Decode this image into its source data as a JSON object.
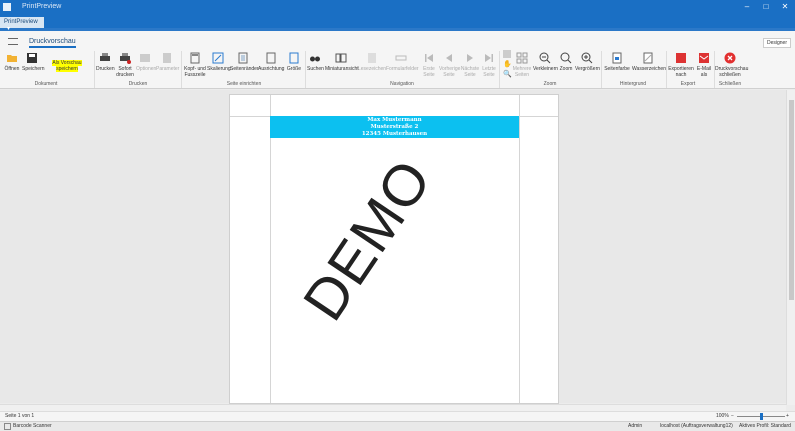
{
  "window": {
    "title": "PrintPreview"
  },
  "tabs": {
    "document_tab": "PrintPreview"
  },
  "ribbon": {
    "tab": "Druckvorschau",
    "designer_label": "Designer",
    "buttons": {
      "open": "Öffnen",
      "save": "Speichern",
      "save_as_preview": "Als Vorschau speichern",
      "print": "Drucken",
      "print_now": "Sofort drucken",
      "options": "Optionen",
      "parameters": "Parameter",
      "header_footer": "Kopf- und Fusszeile",
      "scaling": "Skalierung",
      "margins": "Seitenränder",
      "orientation": "Ausrichtung",
      "size": "Größe",
      "search": "Suchen",
      "thumbnails": "Miniaturansicht",
      "bookmarks": "Lesezeichen",
      "form_fields": "Formularfelder",
      "first_page": "Erste Seite",
      "prev_page": "Vorherige Seite",
      "next_page": "Nächste Seite",
      "last_page": "Letzte Seite",
      "multiple_pages": "Mehrere Seiten",
      "zoom_out": "Verkleinern",
      "zoom": "Zoom",
      "zoom_in": "Vergrößern",
      "page_color": "Seitenfarbe",
      "watermark": "Wasserzeichen",
      "export_to": "Exportieren nach",
      "email_as": "E-Mail als",
      "close_preview": "Druckvorschau schließen"
    },
    "groups": {
      "document": "Dokument",
      "print": "Drucken",
      "page_setup": "Seite einrichten",
      "navigation": "Navigation",
      "zoom": "Zoom",
      "background": "Hintergrund",
      "export": "Export",
      "close": "Schließen"
    }
  },
  "page": {
    "header_line1": "Max Mustermann",
    "header_line2": "Musterstraße 2",
    "header_line3": "12345 Musterhausen",
    "watermark_text": "DEMO"
  },
  "status": {
    "page_info": "Seite 1 von 1",
    "zoom_level": "100%",
    "barcode": "Barcode Scanner",
    "user": "Admin",
    "server": "localhost (Auftragsverwaltung12)",
    "profile": "Aktives Profil: Standard"
  },
  "colors": {
    "titlebar": "#1a6fc4",
    "header_band": "#0cc0f0",
    "highlight": "#ffff00"
  }
}
